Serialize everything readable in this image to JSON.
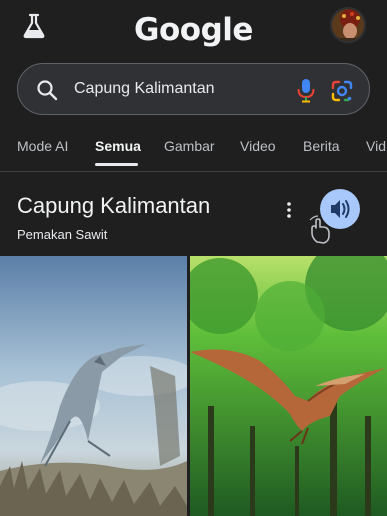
{
  "header": {
    "logo": "Google",
    "lab_icon": "flask-icon",
    "avatar_icon": "profile-avatar"
  },
  "search": {
    "query": "Capung Kalimantan",
    "icons": [
      "search-icon",
      "microphone-icon",
      "google-lens-icon"
    ]
  },
  "tabs": [
    {
      "label": "Mode AI"
    },
    {
      "label": "Semua"
    },
    {
      "label": "Gambar"
    },
    {
      "label": "Video"
    },
    {
      "label": "Berita"
    },
    {
      "label": "Vid"
    }
  ],
  "active_tab": "Semua",
  "result": {
    "title": "Capung Kalimantan",
    "subtitle": "Pemakan Sawit",
    "icons": [
      "more-vert-icon",
      "speaker-icon",
      "tap-hand-icon"
    ]
  },
  "colors": {
    "background": "#1f1f1f",
    "search_bg": "#303134",
    "speaker_button": "#a8c7fa"
  }
}
